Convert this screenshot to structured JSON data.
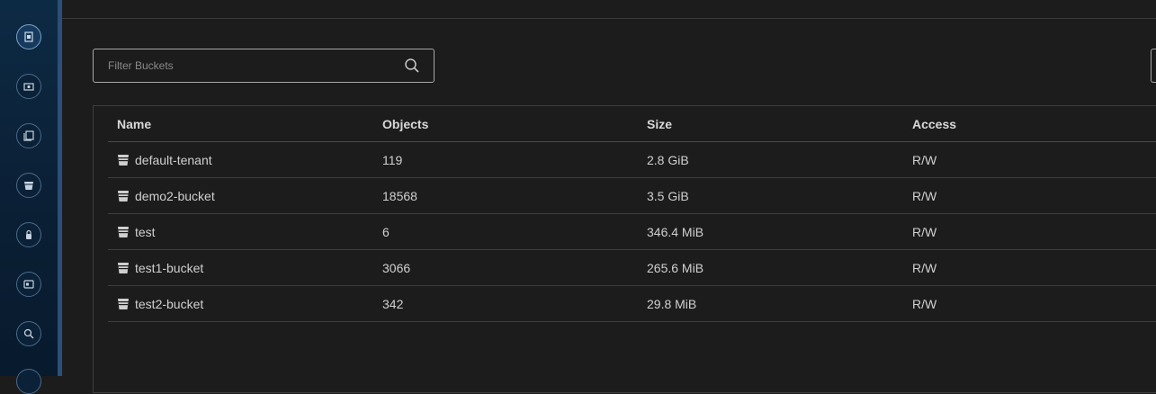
{
  "search": {
    "placeholder": "Filter Buckets"
  },
  "table": {
    "headers": [
      "Name",
      "Objects",
      "Size",
      "Access"
    ],
    "rows": [
      {
        "name": "default-tenant",
        "objects": "119",
        "size": "2.8 GiB",
        "access": "R/W"
      },
      {
        "name": "demo2-bucket",
        "objects": "18568",
        "size": "3.5 GiB",
        "access": "R/W"
      },
      {
        "name": "test",
        "objects": "6",
        "size": "346.4 MiB",
        "access": "R/W"
      },
      {
        "name": "test1-bucket",
        "objects": "3066",
        "size": "265.6 MiB",
        "access": "R/W"
      },
      {
        "name": "test2-bucket",
        "objects": "342",
        "size": "29.8 MiB",
        "access": "R/W"
      }
    ]
  },
  "sidebar": {
    "items": [
      {
        "icon": "dashboard-icon"
      },
      {
        "icon": "account-icon"
      },
      {
        "icon": "documents-icon"
      },
      {
        "icon": "bucket-icon"
      },
      {
        "icon": "security-icon"
      },
      {
        "icon": "id-card-icon"
      },
      {
        "icon": "search-icon"
      }
    ]
  }
}
